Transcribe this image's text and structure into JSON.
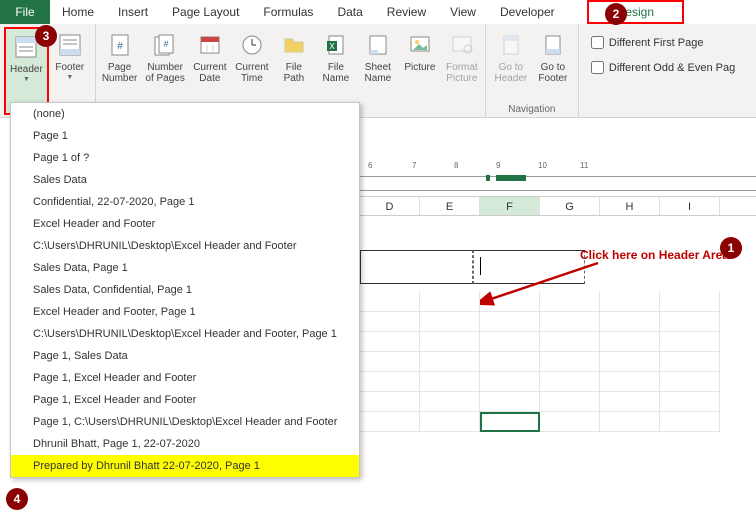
{
  "menu": {
    "file": "File",
    "items": [
      "Home",
      "Insert",
      "Page Layout",
      "Formulas",
      "Data",
      "Review",
      "View",
      "Developer"
    ],
    "design": "Design"
  },
  "ribbon": {
    "headerBtn": "Header",
    "footerBtn": "Footer",
    "grp1Label": "",
    "pageNumber": "Page\nNumber",
    "numberOfPages": "Number\nof Pages",
    "currentDate": "Current\nDate",
    "currentTime": "Current\nTime",
    "filePath": "File\nPath",
    "fileName": "File\nName",
    "sheetName": "Sheet\nName",
    "picture": "Picture",
    "formatPicture": "Format\nPicture",
    "goToHeader": "Go to\nHeader",
    "goToFooter": "Go to\nFooter",
    "navigationLabel": "Navigation",
    "differentFirst": "Different First Page",
    "differentOddEven": "Different Odd & Even Pag"
  },
  "dropdown": [
    "(none)",
    "Page 1",
    "Page 1 of ?",
    "Sales Data",
    " Confidential, 22-07-2020, Page 1",
    "Excel Header and Footer",
    "C:\\Users\\DHRUNIL\\Desktop\\Excel Header and Footer",
    "Sales Data, Page 1",
    "Sales Data,  Confidential, Page 1",
    "Excel Header and Footer, Page 1",
    "C:\\Users\\DHRUNIL\\Desktop\\Excel Header and Footer, Page 1",
    "Page 1, Sales Data",
    "Page 1, Excel Header and Footer",
    "Page 1, Excel Header and Footer",
    "Page 1, C:\\Users\\DHRUNIL\\Desktop\\Excel Header and Footer",
    "Dhrunil Bhatt, Page 1, 22-07-2020",
    "Prepared by Dhrunil Bhatt 22-07-2020, Page 1"
  ],
  "columns": [
    "D",
    "E",
    "F",
    "G",
    "H",
    "I"
  ],
  "rulerTicks": [
    "6",
    "7",
    "8",
    "9",
    "10",
    "11"
  ],
  "annotation": {
    "text": "Click here on Header Area"
  },
  "badges": {
    "b1": "1",
    "b2": "2",
    "b3": "3",
    "b4": "4"
  }
}
